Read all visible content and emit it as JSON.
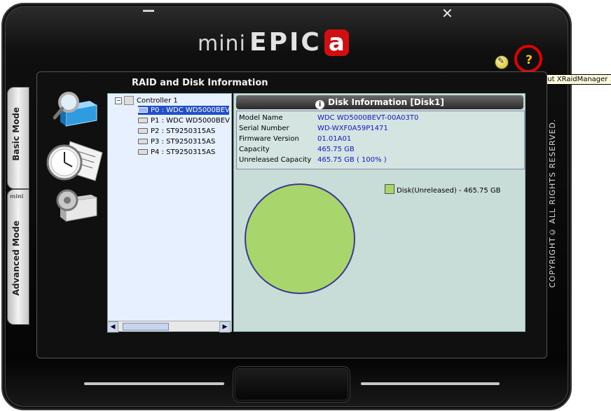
{
  "window": {
    "close_glyph": "✕"
  },
  "logo": {
    "part1": "mini",
    "part2": "EPIC",
    "part3": "a"
  },
  "help": {
    "label": "?",
    "tooltip": "About XRaidManager ..."
  },
  "panel": {
    "title": "RAID and Disk Information"
  },
  "tabs": {
    "basic": "Basic Mode",
    "advanced": "Advanced Mode",
    "mini": "mini"
  },
  "tree": {
    "controller": "Controller 1",
    "disks": [
      "P0 : WDC WD5000BEV",
      "P1 : WDC WD5000BEV",
      "P2 : ST9250315AS",
      "P3 : ST9250315AS",
      "P4 : ST9250315AS"
    ],
    "selected_index": 0
  },
  "disk_info": {
    "header": "Disk Information  [Disk1]",
    "rows": [
      {
        "label": "Model Name",
        "value": "WDC WD5000BEVT-00A03T0"
      },
      {
        "label": "Serial Number",
        "value": "WD-WXF0A59P1471"
      },
      {
        "label": "Firmware Version",
        "value": "01.01A01"
      },
      {
        "label": "Capacity",
        "value": "465.75 GB"
      },
      {
        "label": "Unreleased Capacity",
        "value": "465.75 GB ( 100% )"
      }
    ]
  },
  "chart_data": {
    "type": "pie",
    "slices": [
      {
        "name": "Disk(Unreleased) - 465.75 GB",
        "value": 465.75,
        "color": "#a8d56c"
      }
    ]
  },
  "legend_text": "Disk(Unreleased) - 465.75 GB",
  "copyright": "COPYRIGHT© ALL RIGHTS RESERVED.",
  "colors": {
    "accent_red": "#d20f10",
    "selection": "#2150c8",
    "value_blue": "#1515d0",
    "pie_fill": "#a8d56c",
    "pie_edge": "#3a3a8a"
  }
}
